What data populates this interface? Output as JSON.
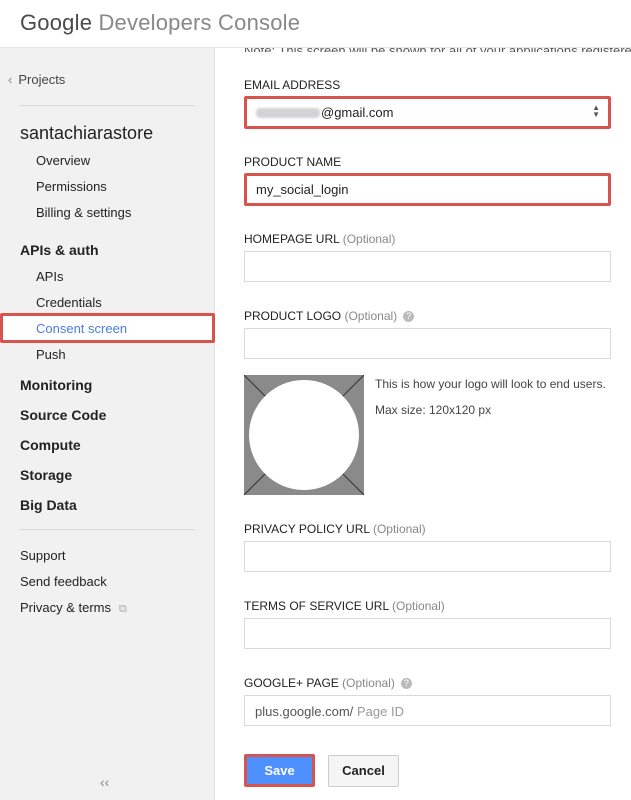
{
  "header": {
    "logo_google": "Google",
    "logo_product": "Developers Console"
  },
  "sidebar": {
    "projects_label": "Projects",
    "project_name": "santachiarastore",
    "project_items": [
      "Overview",
      "Permissions",
      "Billing & settings"
    ],
    "apis_heading": "APIs & auth",
    "apis_items": {
      "apis": "APIs",
      "credentials": "Credentials",
      "consent": "Consent screen",
      "push": "Push"
    },
    "sections": [
      "Monitoring",
      "Source Code",
      "Compute",
      "Storage",
      "Big Data"
    ],
    "footer": {
      "support": "Support",
      "feedback": "Send feedback",
      "privacy": "Privacy & terms"
    },
    "collapse": "‹‹"
  },
  "form": {
    "note": "Note: This screen will be shown for all of your applications registered",
    "email": {
      "label": "EMAIL ADDRESS",
      "value_suffix": "@gmail.com"
    },
    "product_name": {
      "label": "PRODUCT NAME",
      "value": "my_social_login"
    },
    "homepage": {
      "label": "HOMEPAGE URL",
      "optional": "(Optional)",
      "value": ""
    },
    "product_logo": {
      "label": "PRODUCT LOGO",
      "optional": "(Optional)",
      "value": ""
    },
    "logo_preview": {
      "caption": "This is how your logo will look to end users.",
      "max_size": "Max size: 120x120 px"
    },
    "privacy": {
      "label": "PRIVACY POLICY URL",
      "optional": "(Optional)",
      "value": ""
    },
    "terms": {
      "label": "TERMS OF SERVICE URL",
      "optional": "(Optional)",
      "value": ""
    },
    "gplus": {
      "label": "GOOGLE+ PAGE",
      "optional": "(Optional)",
      "prefix": "plus.google.com/",
      "placeholder": "Page ID"
    },
    "save_label": "Save",
    "cancel_label": "Cancel"
  },
  "colors": {
    "highlight": "#d9534f",
    "primary": "#4d90fe",
    "active_link": "#4a7de0"
  }
}
